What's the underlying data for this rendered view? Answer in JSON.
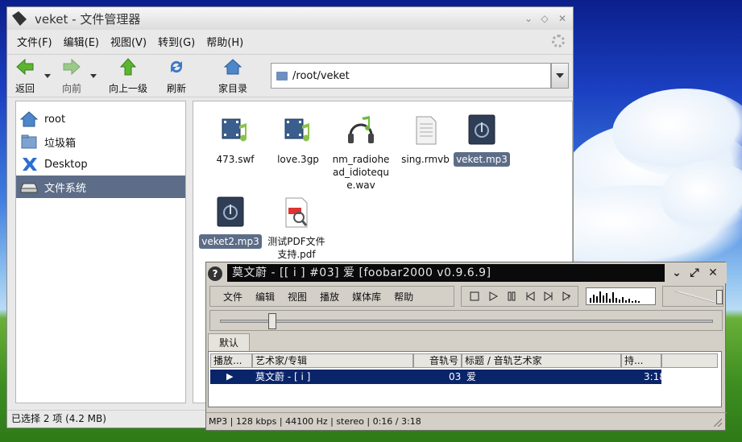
{
  "file_manager": {
    "title": "veket - 文件管理器",
    "menu": [
      "文件(F)",
      "编辑(E)",
      "视图(V)",
      "转到(G)",
      "帮助(H)"
    ],
    "toolbar": {
      "back": "返回",
      "forward": "向前",
      "up": "向上一级",
      "refresh": "刷新",
      "home": "家目录"
    },
    "address": "/root/veket",
    "sidebar": [
      {
        "label": "root",
        "icon": "home-icon"
      },
      {
        "label": "垃圾箱",
        "icon": "trash-icon"
      },
      {
        "label": "Desktop",
        "icon": "desktop-icon"
      },
      {
        "label": "文件系统",
        "icon": "drive-icon",
        "selected": true
      }
    ],
    "files": [
      {
        "name": "473.swf",
        "icon": "video-file-icon",
        "selected": false
      },
      {
        "name": "love.3gp",
        "icon": "video-file-icon",
        "selected": false
      },
      {
        "name": "nm_radiohead_idioteque.wav",
        "icon": "audio-file-icon",
        "selected": false
      },
      {
        "name": "sing.rmvb",
        "icon": "text-file-icon",
        "selected": false
      },
      {
        "name": "veket.mp3",
        "icon": "mp3-file-icon",
        "selected": true
      },
      {
        "name": "veket2.mp3",
        "icon": "mp3-file-icon",
        "selected": true
      },
      {
        "name": "测试PDF文件支持.pdf",
        "icon": "pdf-file-icon",
        "selected": false
      }
    ],
    "status": "已选择 2 项 (4.2 MB)"
  },
  "foobar": {
    "help": "?",
    "title": "莫文蔚 - [[ i ] #03] 爱   [foobar2000 v0.9.6.9]",
    "menu": [
      "文件",
      "编辑",
      "视图",
      "播放",
      "媒体库",
      "帮助"
    ],
    "seek_fraction": 0.1,
    "volume_fraction": 1.0,
    "tab": "默认",
    "columns": [
      "播放...",
      "艺术家/专辑",
      "音轨号",
      "标题 / 音轨艺术家",
      "持..."
    ],
    "row": {
      "artist": "莫文蔚 - [ i ]",
      "track": "03",
      "title": "爱",
      "duration": "3:18"
    },
    "status": "MP3 | 128 kbps | 44100 Hz | stereo | 0:16 / 3:18"
  }
}
